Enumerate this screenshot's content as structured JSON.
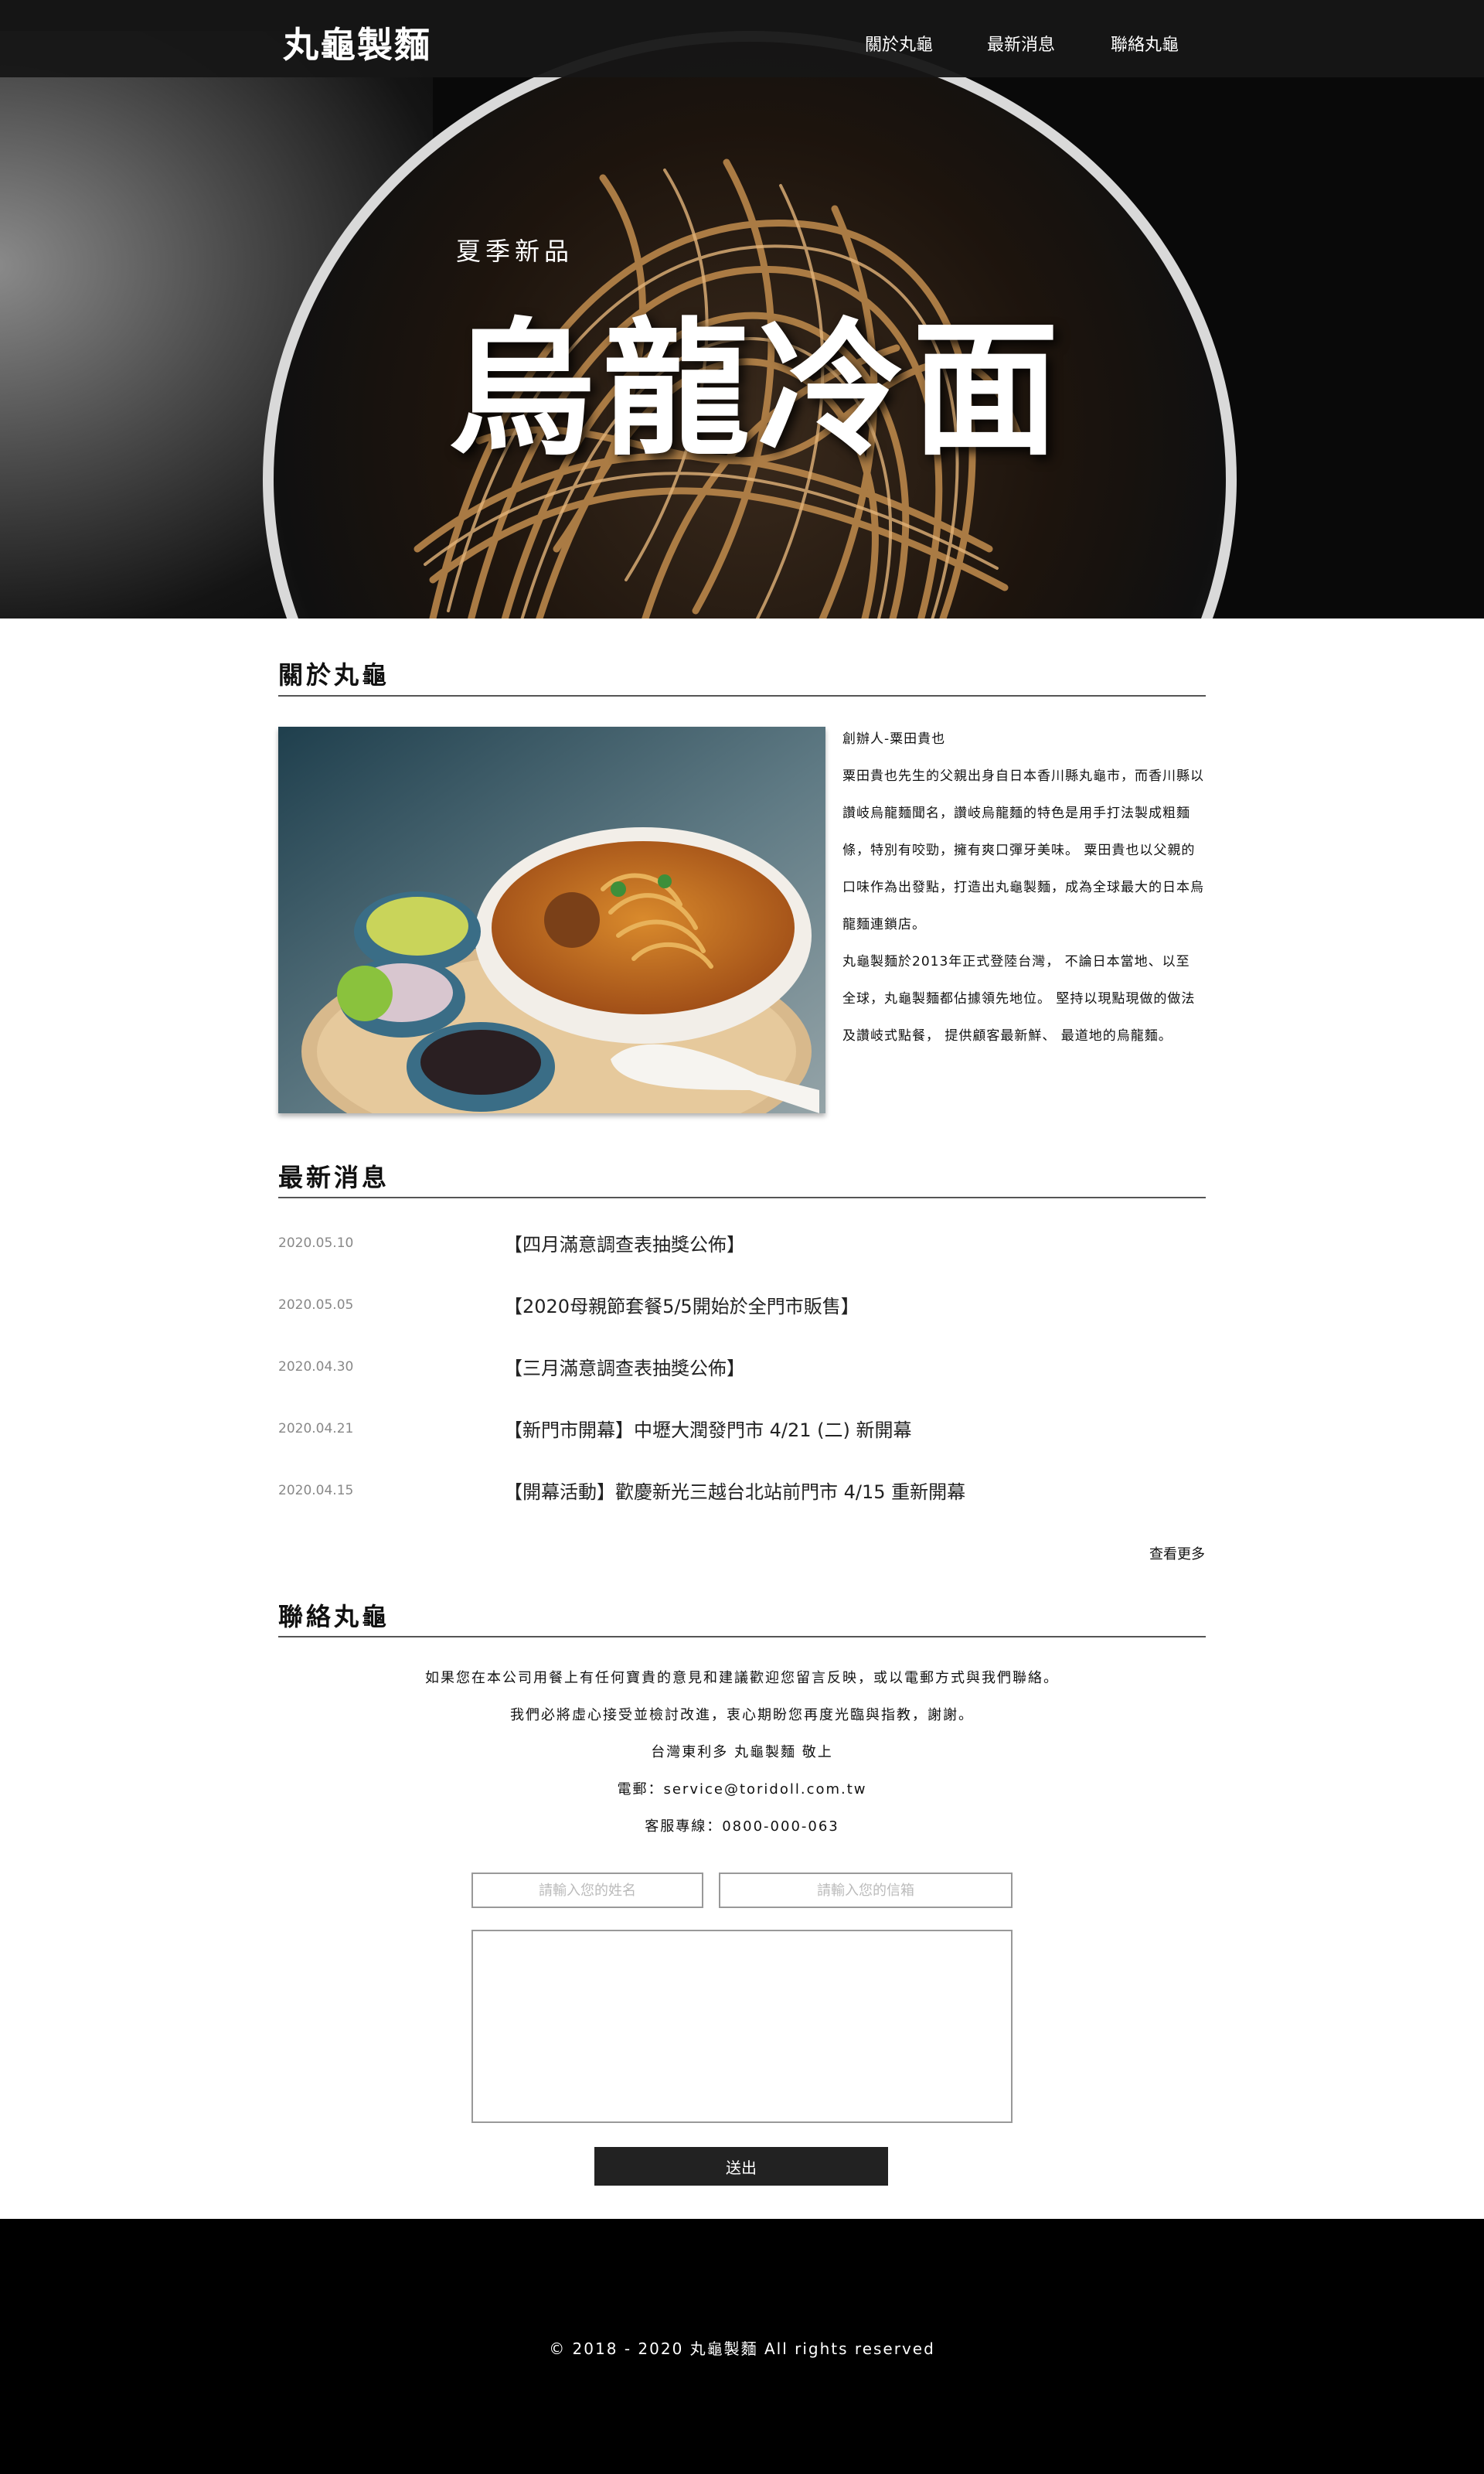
{
  "header": {
    "logo": "丸龜製麵",
    "nav": [
      "關於丸龜",
      "最新消息",
      "聯絡丸龜"
    ]
  },
  "hero": {
    "subtitle": "夏季新品",
    "title": "烏龍冷面"
  },
  "about": {
    "heading": "關於丸龜",
    "founder": "創辦人-粟田貴也",
    "paragraph1": "粟田貴也先生的父親出身自日本香川縣丸龜市，而香川縣以讚岐烏龍麵聞名，讚岐烏龍麵的特色是用手打法製成粗麵條，特別有咬勁，擁有爽口彈牙美味。 粟田貴也以父親的 口味作為出發點，打造出丸龜製麵，成為全球最大的日本烏龍麵連鎖店。",
    "paragraph2": "丸龜製麵於2013年正式登陸台灣， 不論日本當地、以至 全球，丸龜製麵都佔據領先地位。 堅持以現點現做的做法及讚岐式點餐， 提供顧客最新鮮、 最道地的烏龍麵。"
  },
  "news": {
    "heading": "最新消息",
    "items": [
      {
        "date": "2020.05.10",
        "title": "【四月滿意調查表抽獎公佈】"
      },
      {
        "date": "2020.05.05",
        "title": "【2020母親節套餐5/5開始於全門市販售】"
      },
      {
        "date": "2020.04.30",
        "title": "【三月滿意調查表抽獎公佈】"
      },
      {
        "date": "2020.04.21",
        "title": "【新門市開幕】中壢大潤發門市 4/21 (二) 新開幕"
      },
      {
        "date": "2020.04.15",
        "title": "【開幕活動】歡慶新光三越台北站前門市 4/15 重新開幕"
      }
    ],
    "more": "查看更多"
  },
  "contact": {
    "heading": "聯絡丸龜",
    "lines": [
      "如果您在本公司用餐上有任何寶貴的意見和建議歡迎您留言反映，或以電郵方式與我們聯絡。",
      "我們必將虛心接受並檢討改進，衷心期盼您再度光臨與指教，謝謝。",
      "台灣東利多 丸龜製麵 敬上",
      "電郵：service@toridoll.com.tw",
      "客服專線：0800-000-063"
    ],
    "name_placeholder": "請輸入您的姓名",
    "email_placeholder": "請輸入您的信箱",
    "submit": "送出"
  },
  "footer": {
    "copyright": "© 2018 - 2020 丸龜製麵 All rights reserved"
  },
  "colors": {
    "nav_bg": "#161616",
    "footer_bg": "#000000",
    "button_bg": "#222222",
    "date_text": "#888888"
  }
}
